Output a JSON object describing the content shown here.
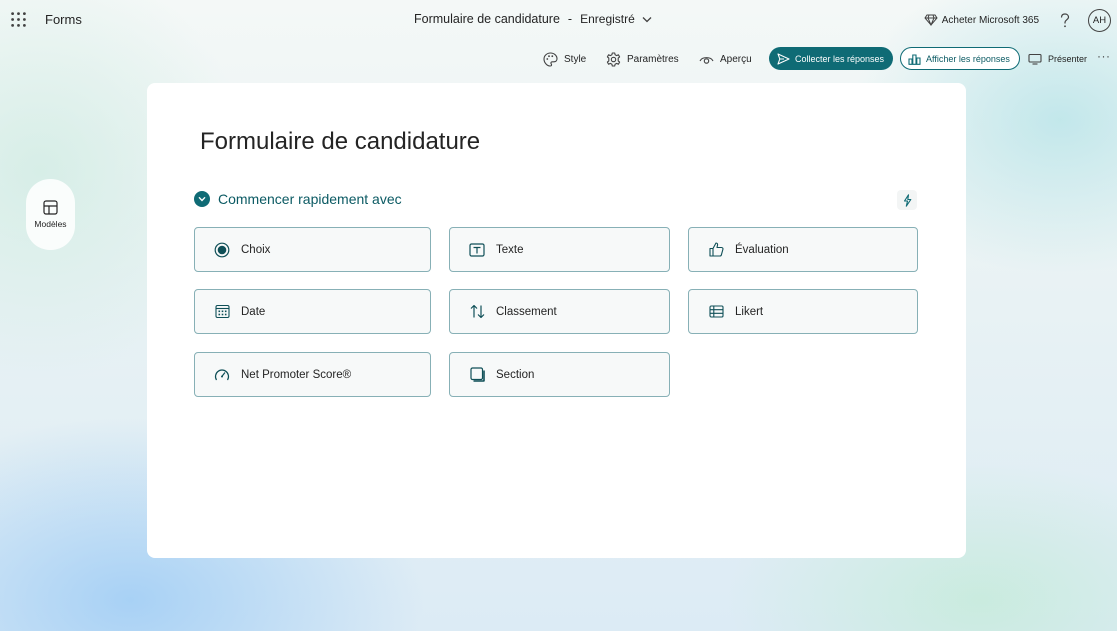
{
  "app": {
    "name": "Forms",
    "waffle_icon": "app-launcher-icon"
  },
  "header": {
    "doc_title": "Formulaire de candidature",
    "separator": "-",
    "save_status": "Enregistré",
    "buy_label": "Acheter Microsoft 365",
    "help_label": "?",
    "avatar_initials": "AH"
  },
  "toolbar": {
    "style_label": "Style",
    "settings_label": "Paramètres",
    "preview_label": "Aperçu",
    "collect_label": "Collecter les réponses",
    "view_answers_label": "Afficher les réponses",
    "present_label": "Présenter",
    "more_label": "···"
  },
  "sidebar": {
    "templates_label": "Modèles"
  },
  "form": {
    "title": "Formulaire de candidature",
    "quick_start_label": "Commencer rapidement avec",
    "question_types": [
      {
        "label": "Choix",
        "icon": "radio-icon"
      },
      {
        "label": "Texte",
        "icon": "text-box-icon"
      },
      {
        "label": "Évaluation",
        "icon": "thumb-up-icon"
      },
      {
        "label": "Date",
        "icon": "calendar-icon"
      },
      {
        "label": "Classement",
        "icon": "sort-arrows-icon"
      },
      {
        "label": "Likert",
        "icon": "table-list-icon"
      },
      {
        "label": "Net Promoter Score®",
        "icon": "gauge-icon"
      },
      {
        "label": "Section",
        "icon": "section-icon"
      }
    ]
  },
  "colors": {
    "accent": "#0f6b75",
    "accent_text": "#0b5a63",
    "button_border": "#87b0b6"
  }
}
